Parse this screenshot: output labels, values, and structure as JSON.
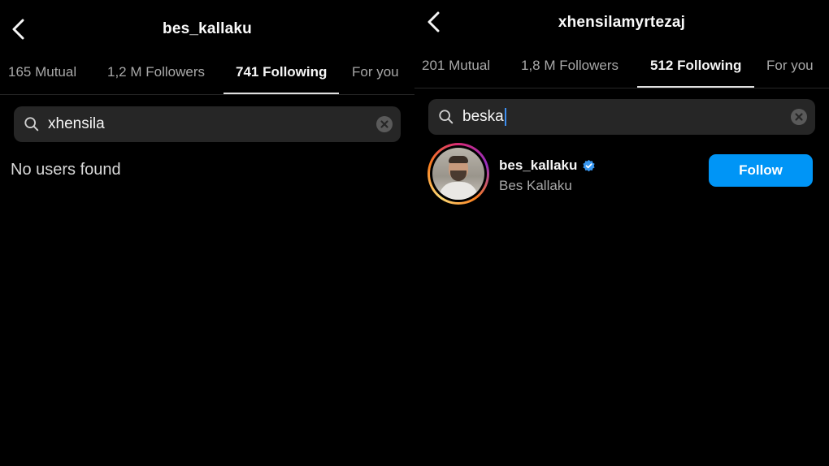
{
  "left": {
    "title": "bes_kallaku",
    "tabs": [
      {
        "label": "165 Mutual",
        "active": false
      },
      {
        "label": "1,2 M Followers",
        "active": false
      },
      {
        "label": "741 Following",
        "active": true
      },
      {
        "label": "For you",
        "active": false
      }
    ],
    "search": {
      "value": "xhensila"
    },
    "empty_message": "No users found"
  },
  "right": {
    "title": "xhensilamyrtezaj",
    "tabs": [
      {
        "label": "201 Mutual",
        "active": false
      },
      {
        "label": "1,8 M Followers",
        "active": false
      },
      {
        "label": "512 Following",
        "active": true
      },
      {
        "label": "For you",
        "active": false
      }
    ],
    "search": {
      "value": "beska"
    },
    "result": {
      "username": "bes_kallaku",
      "full_name": "Bes Kallaku",
      "verified": true,
      "follow_label": "Follow"
    }
  },
  "colors": {
    "background": "#000000",
    "follow_button": "#0095f6",
    "verified_badge": "#3897f0",
    "search_field": "#262626"
  },
  "icons": [
    "back-arrow-icon",
    "search-icon",
    "clear-icon",
    "verified-badge-icon"
  ]
}
